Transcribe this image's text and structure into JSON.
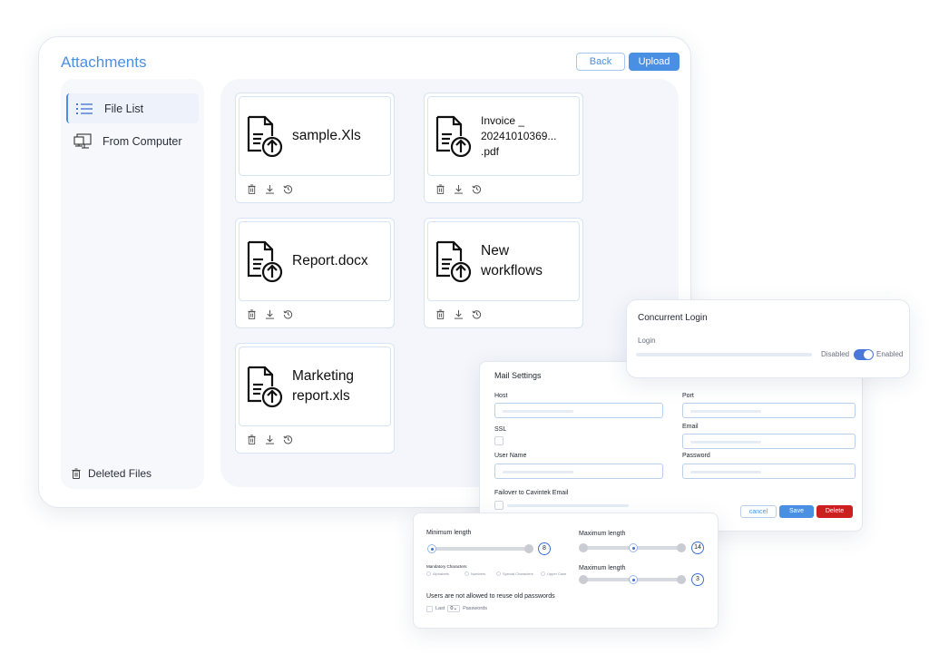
{
  "attachments": {
    "title": "Attachments",
    "back_label": "Back",
    "upload_label": "Upload",
    "sidebar": {
      "items": [
        {
          "label": "File List",
          "icon": "list-icon",
          "active": true
        },
        {
          "label": "From Computer",
          "icon": "computer-icon",
          "active": false
        }
      ],
      "deleted_label": "Deleted Files"
    },
    "files": [
      {
        "name": "sample.Xls"
      },
      {
        "name_line1": "Invoice _",
        "name_line2": "20241010369...",
        "name_line3": ".pdf"
      },
      {
        "name": "Report.docx"
      },
      {
        "name_line1": "New",
        "name_line2": "workflows"
      },
      {
        "name_line1": "Marketing",
        "name_line2": "report.xls"
      }
    ]
  },
  "concurrent_login": {
    "title": "Concurrent Login",
    "login_label": "Login",
    "disabled_label": "Disabled",
    "enabled_label": "Enabled",
    "enabled": true
  },
  "mail_settings": {
    "title": "Mail Settings",
    "host_label": "Host",
    "port_label": "Port",
    "ssl_label": "SSL",
    "email_label": "Email",
    "username_label": "User Name",
    "password_label": "Password",
    "failover_label": "Failover to Cavintek Email",
    "cancel_label": "cancel",
    "save_label": "Save",
    "delete_label": "Delete"
  },
  "password_policy": {
    "min_length_label": "Minimum length",
    "min_length_value": "8",
    "max_length_label_1": "Maximum length",
    "max_length_value_1": "14",
    "max_length_label_2": "Maximum length",
    "max_length_value_2": "3",
    "mandatory_label": "Mandatory Characters",
    "options": [
      "Alphabets",
      "Numbers",
      "Special Characters",
      "Upper Case"
    ],
    "reuse_label": "Users are not allowed to reuse old passwords",
    "last_label": "Last",
    "last_value": "0",
    "passwords_label": "Passwords"
  },
  "colors": {
    "accent": "#4a90e2",
    "delete": "#cc1f1f",
    "toggle_on": "#4a78d8"
  }
}
